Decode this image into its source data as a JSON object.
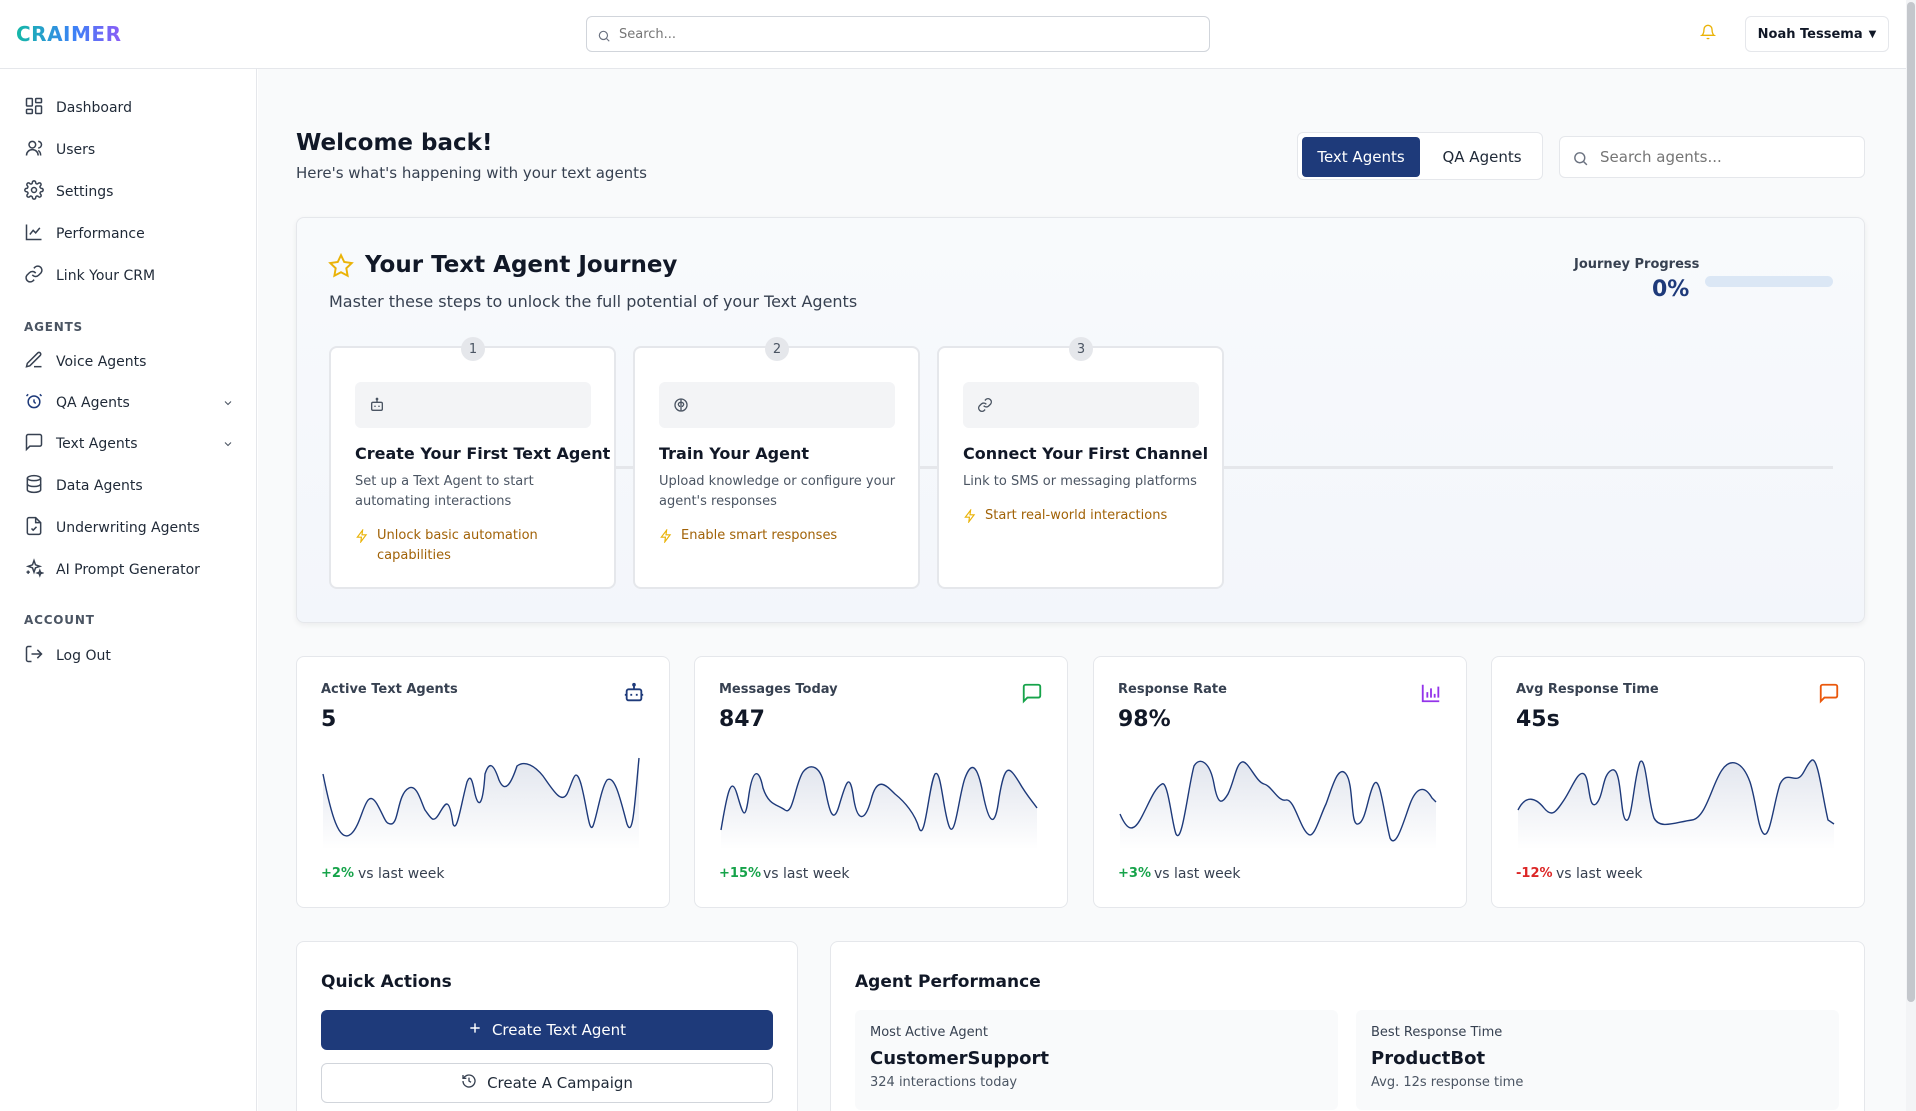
{
  "header": {
    "logo": "CRAIMER",
    "search_placeholder": "Search...",
    "user_name": "Noah Tessema",
    "user_caret": "▼"
  },
  "sidebar": {
    "items": [
      {
        "label": "Dashboard",
        "icon": "dashboard-icon"
      },
      {
        "label": "Users",
        "icon": "users-icon"
      },
      {
        "label": "Settings",
        "icon": "gear-icon"
      },
      {
        "label": "Performance",
        "icon": "line-chart-icon"
      },
      {
        "label": "Link Your CRM",
        "icon": "link-icon"
      }
    ],
    "agents_section": "AGENTS",
    "agent_items": [
      {
        "label": "Voice Agents",
        "icon": "pen-icon"
      },
      {
        "label": "QA Agents",
        "icon": "qa-icon",
        "expandable": true
      },
      {
        "label": "Text Agents",
        "icon": "message-icon",
        "expandable": true
      },
      {
        "label": "Data Agents",
        "icon": "database-icon"
      },
      {
        "label": "Underwriting Agents",
        "icon": "file-icon"
      },
      {
        "label": "AI Prompt Generator",
        "icon": "sparkles-icon"
      }
    ],
    "account_section": "ACCOUNT",
    "account_items": [
      {
        "label": "Log Out",
        "icon": "logout-icon"
      }
    ]
  },
  "main": {
    "welcome_title": "Welcome back!",
    "welcome_subtitle": "Here's what's happening with your text agents",
    "tabs": [
      {
        "label": "Text Agents",
        "active": true
      },
      {
        "label": "QA Agents",
        "active": false
      }
    ],
    "agent_search_placeholder": "Search agents..."
  },
  "journey": {
    "title": "Your Text Agent Journey",
    "subtitle": "Master these steps to unlock the full potential of your Text Agents",
    "progress_label": "Journey Progress",
    "progress_value": "0%",
    "progress_fraction": 0,
    "steps": [
      {
        "number": "1",
        "icon": "bot-icon",
        "title": "Create Your First Text Agent",
        "description": "Set up a Text Agent to start automating interactions",
        "perk": "Unlock basic automation capabilities"
      },
      {
        "number": "2",
        "icon": "brain-icon",
        "title": "Train Your Agent",
        "description": "Upload knowledge or configure your agent's responses",
        "perk": "Enable smart responses"
      },
      {
        "number": "3",
        "icon": "link-icon",
        "title": "Connect Your First Channel",
        "description": "Link to SMS or messaging platforms",
        "perk": "Start real-world interactions"
      }
    ]
  },
  "stats": [
    {
      "label": "Active Text Agents",
      "value": "5",
      "change": "+2%",
      "change_color": "#16a34a",
      "vs": "vs last week",
      "icon": "bot-icon",
      "icon_color": "#1e3a7a"
    },
    {
      "label": "Messages Today",
      "value": "847",
      "change": "+15%",
      "change_color": "#16a34a",
      "vs": "vs last week",
      "icon": "message-icon",
      "icon_color": "#16a34a"
    },
    {
      "label": "Response Rate",
      "value": "98%",
      "change": "+3%",
      "change_color": "#16a34a",
      "vs": "vs last week",
      "icon": "bar-chart-icon",
      "icon_color": "#9333ea"
    },
    {
      "label": "Avg Response Time",
      "value": "45s",
      "change": "-12%",
      "change_color": "#dc2626",
      "vs": "vs last week",
      "icon": "message-icon",
      "icon_color": "#ea580c"
    }
  ],
  "quick_actions": {
    "title": "Quick Actions",
    "primary_label": "Create Text Agent",
    "secondary_label": "Create A Campaign"
  },
  "agent_performance": {
    "title": "Agent Performance",
    "boxes": [
      {
        "label": "Most Active Agent",
        "value": "CustomerSupport",
        "sub": "324 interactions today"
      },
      {
        "label": "Best Response Time",
        "value": "ProductBot",
        "sub": "Avg. 12s response time"
      }
    ]
  },
  "colors": {
    "accent": "#1e3a7a",
    "perk": "#a16207",
    "positive": "#16a34a",
    "negative": "#dc2626"
  }
}
